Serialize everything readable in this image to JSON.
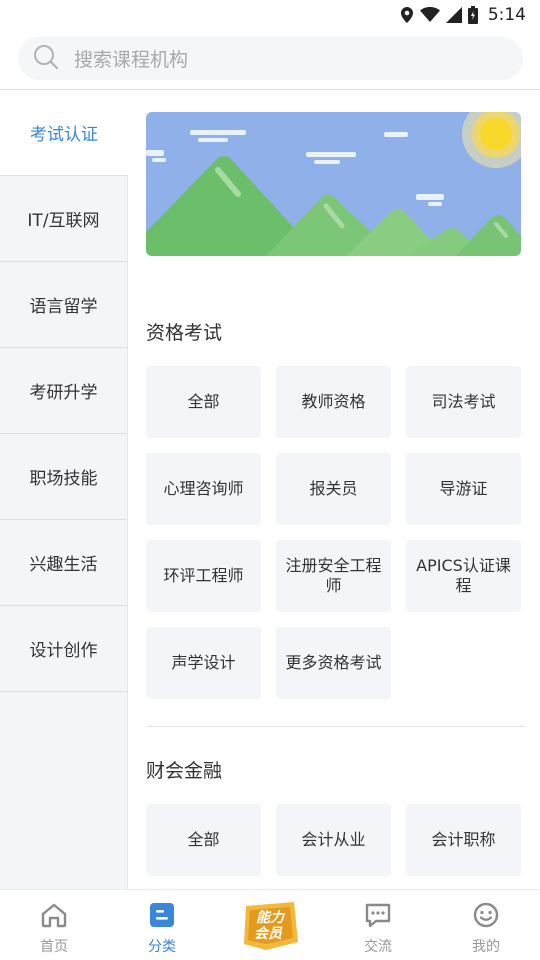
{
  "status_bar": {
    "time": "5:14"
  },
  "search": {
    "placeholder": "搜索课程机构"
  },
  "sidebar": {
    "items": [
      {
        "label": "考试认证",
        "active": true
      },
      {
        "label": "IT/互联网"
      },
      {
        "label": "语言留学"
      },
      {
        "label": "考研升学"
      },
      {
        "label": "职场技能"
      },
      {
        "label": "兴趣生活"
      },
      {
        "label": "设计创作"
      }
    ]
  },
  "sections": [
    {
      "title": "资格考试",
      "items": [
        "全部",
        "教师资格",
        "司法考试",
        "心理咨询师",
        "报关员",
        "导游证",
        "环评工程师",
        "注册安全工程师",
        "APICS认证课程",
        "声学设计",
        "更多资格考试"
      ]
    },
    {
      "title": "财会金融",
      "items": [
        "全部",
        "会计从业",
        "会计职称"
      ]
    }
  ],
  "bottom_nav": {
    "items": [
      {
        "label": "首页",
        "icon": "home-icon"
      },
      {
        "label": "分类",
        "icon": "category-icon",
        "active": true
      },
      {
        "label": "能力会员",
        "icon": "vip-badge-icon"
      },
      {
        "label": "交流",
        "icon": "chat-icon"
      },
      {
        "label": "我的",
        "icon": "profile-icon"
      }
    ]
  },
  "colors": {
    "accent": "#3a86d8",
    "sidebar_bg": "#f4f5f7",
    "chip_bg": "#f4f5f8"
  }
}
